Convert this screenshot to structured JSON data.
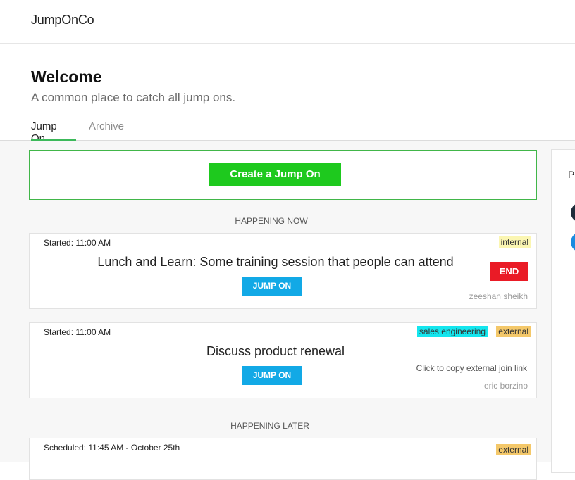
{
  "app": {
    "brand": "JumpOnCo"
  },
  "hero": {
    "title": "Welcome",
    "subtitle": "A common place to catch all jump ons."
  },
  "tabs": [
    {
      "label": "Jump On",
      "active": true
    },
    {
      "label": "Archive",
      "active": false
    }
  ],
  "create": {
    "label": "Create a Jump On"
  },
  "sections": {
    "now": "HAPPENING NOW",
    "later": "HAPPENING LATER"
  },
  "now_cards": [
    {
      "started": "Started: 11:00 AM",
      "title": "Lunch and Learn: Some training session that people can attend",
      "jump_label": "JUMP ON",
      "end_label": "END",
      "owner": "zeeshan sheikh",
      "tags": [
        "internal"
      ]
    },
    {
      "started": "Started: 11:00 AM",
      "title": "Discuss product renewal",
      "jump_label": "JUMP ON",
      "copy_link": "Click to copy external join link",
      "owner": "eric borzino",
      "tags": [
        "sales engineering",
        "external"
      ]
    }
  ],
  "later_cards": [
    {
      "scheduled": "Scheduled: 11:45 AM - October 25th",
      "tags": [
        "external"
      ]
    }
  ],
  "side_panel": {
    "title": "P"
  },
  "colors": {
    "accent_green": "#1ec91e",
    "jump_blue": "#12a9e6",
    "end_red": "#ea1b26",
    "tag_internal": "#fbf6b2",
    "tag_sales": "#14e6ee",
    "tag_external": "#f4c86a"
  }
}
